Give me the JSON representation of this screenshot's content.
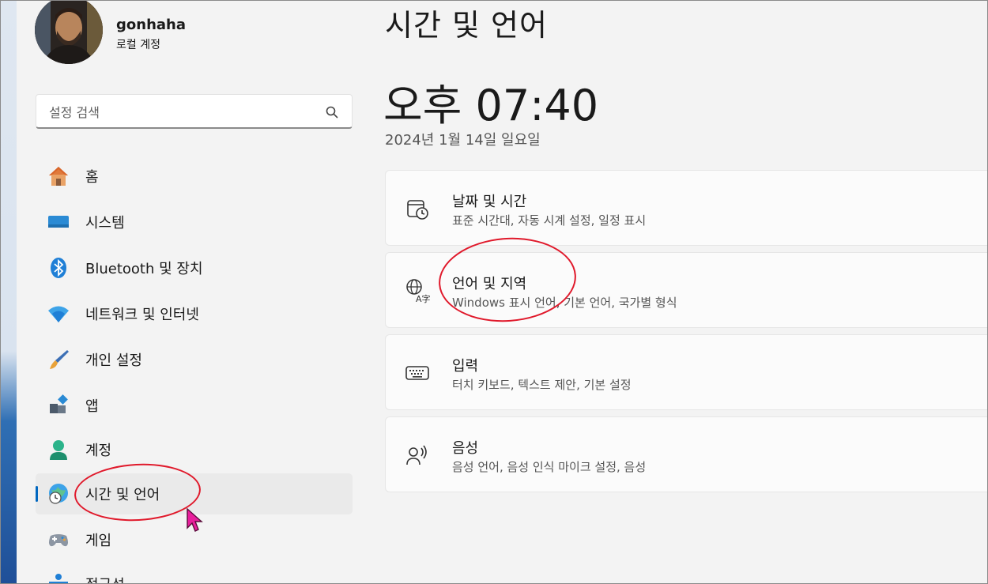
{
  "profile": {
    "name": "gonhaha",
    "account_type": "로컬 계정",
    "avatar_icon": "user-avatar-photo"
  },
  "search": {
    "placeholder": "설정 검색",
    "value": ""
  },
  "nav": [
    {
      "label": "홈",
      "icon": "home-icon"
    },
    {
      "label": "시스템",
      "icon": "display-icon"
    },
    {
      "label": "Bluetooth 및 장치",
      "icon": "bluetooth-icon"
    },
    {
      "label": "네트워크 및 인터넷",
      "icon": "wifi-icon"
    },
    {
      "label": "개인 설정",
      "icon": "brush-icon"
    },
    {
      "label": "앱",
      "icon": "apps-icon"
    },
    {
      "label": "계정",
      "icon": "account-icon"
    },
    {
      "label": "시간 및 언어",
      "icon": "globe-clock-icon",
      "active": true
    },
    {
      "label": "게임",
      "icon": "gamepad-icon"
    },
    {
      "label": "접근성",
      "icon": "accessibility-icon"
    }
  ],
  "main": {
    "title": "시간 및 언어",
    "time": "오후 07:40",
    "date": "2024년 1월 14일 일요일",
    "cards": [
      {
        "title": "날짜 및 시간",
        "subtitle": "표준 시간대, 자동 시계 설정, 일정 표시",
        "icon": "calendar-clock-icon"
      },
      {
        "title": "언어 및 지역",
        "subtitle": "Windows 표시 언어, 기본 언어, 국가별 형식",
        "icon": "language-icon"
      },
      {
        "title": "입력",
        "subtitle": "터치 키보드, 텍스트 제안, 기본 설정",
        "icon": "keyboard-icon"
      },
      {
        "title": "음성",
        "subtitle": "음성 언어, 음성 인식 마이크 설정, 음성",
        "icon": "speech-icon"
      }
    ]
  },
  "colors": {
    "accent": "#0067c0",
    "annotation": "#e0192b",
    "cursor": "#e81e9c",
    "window_bg": "#f3f3f3",
    "card_bg": "#fbfbfb"
  }
}
